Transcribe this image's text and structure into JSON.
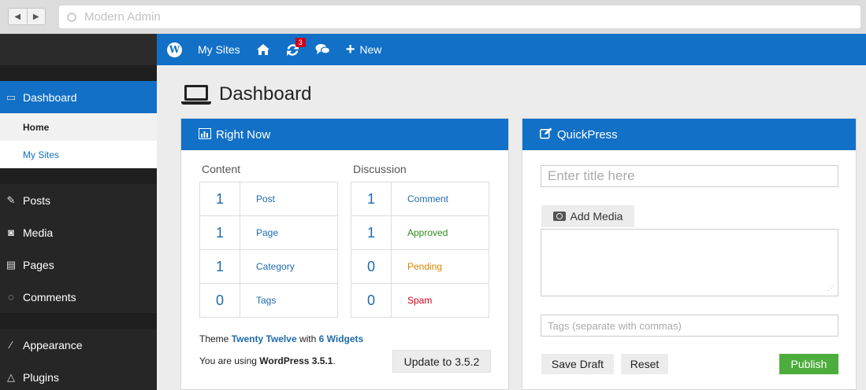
{
  "browser": {
    "url_placeholder": "Modern Admin",
    "back_glyph": "◀",
    "forward_glyph": "▶"
  },
  "adminbar": {
    "logo": "W",
    "my_sites": "My Sites",
    "updates_count": "3",
    "new_label": "New"
  },
  "sidebar": {
    "dashboard": "Dashboard",
    "home": "Home",
    "my_sites": "My Sites",
    "posts": "Posts",
    "media": "Media",
    "pages": "Pages",
    "comments": "Comments",
    "appearance": "Appearance",
    "plugins": "Plugins"
  },
  "page": {
    "title": "Dashboard"
  },
  "right_now": {
    "title": "Right Now",
    "content_title": "Content",
    "discussion_title": "Discussion",
    "content": [
      {
        "count": "1",
        "label": "Post"
      },
      {
        "count": "1",
        "label": "Page"
      },
      {
        "count": "1",
        "label": "Category"
      },
      {
        "count": "0",
        "label": "Tags"
      }
    ],
    "discussion": [
      {
        "count": "1",
        "label": "Comment"
      },
      {
        "count": "1",
        "label": "Approved"
      },
      {
        "count": "0",
        "label": "Pending"
      },
      {
        "count": "0",
        "label": "Spam"
      }
    ],
    "theme_prefix": "Theme",
    "theme_name": "Twenty Twelve",
    "theme_with": "with",
    "widgets": "6 Widgets",
    "using_prefix": "You are using",
    "wp_version": "WordPress 3.5.1",
    "using_suffix": ".",
    "update_button": "Update to 3.5.2"
  },
  "quickpress": {
    "title": "QuickPress",
    "title_placeholder": "Enter title here",
    "add_media": "Add Media",
    "tags_placeholder": "Tags (separate with commas)",
    "save_draft": "Save Draft",
    "reset": "Reset",
    "publish": "Publish"
  },
  "colors": {
    "accent": "#1270c7",
    "sidebar_bg": "#1f1f1f",
    "publish": "#4cad3c",
    "approved": "#2e8b1d",
    "pending": "#d98500",
    "spam": "#d0021b"
  }
}
